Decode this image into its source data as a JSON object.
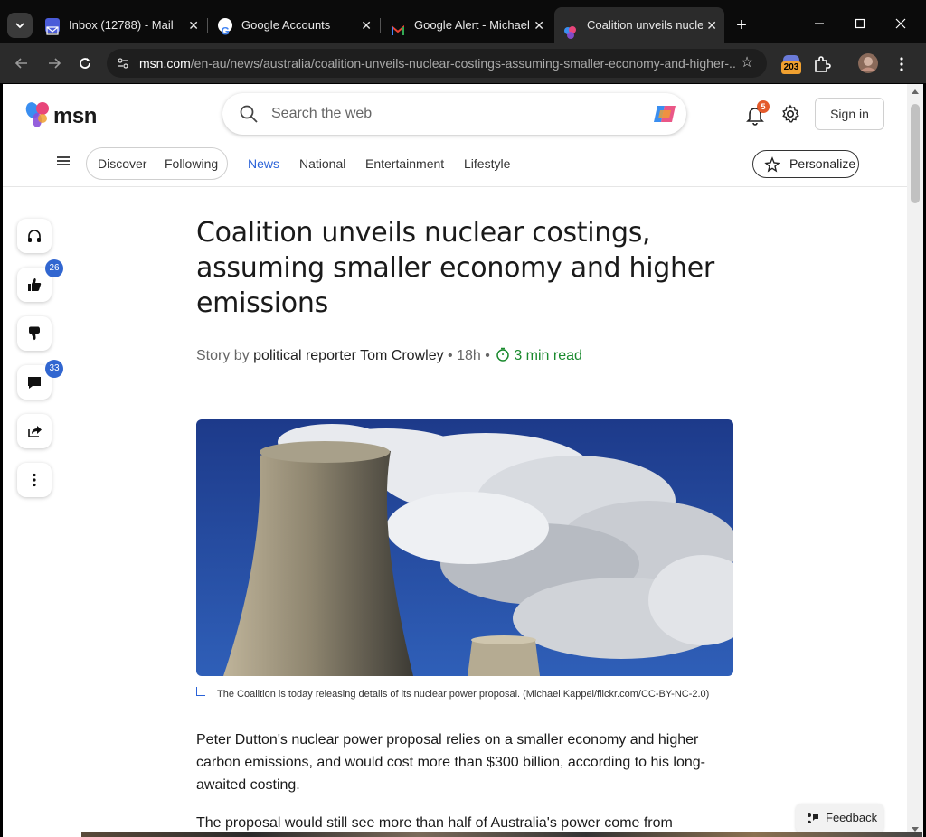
{
  "tabs": [
    {
      "title": "Inbox (12788) - Mail",
      "favicon": "mail-icon",
      "active": false
    },
    {
      "title": "Google Accounts",
      "favicon": "google-icon",
      "active": false
    },
    {
      "title": "Google Alert - Michael I",
      "favicon": "gmail-icon",
      "active": false
    },
    {
      "title": "Coalition unveils nuclea",
      "favicon": "msn-icon",
      "active": true
    }
  ],
  "address_bar": {
    "host": "msn.com",
    "path": "/en-au/news/australia/coalition-unveils-nuclear-costings-assuming-smaller-economy-and-higher-..."
  },
  "extensions": {
    "badge": "203"
  },
  "msn": {
    "logo_text": "msn",
    "search_placeholder": "Search the web",
    "notifications_count": "5",
    "sign_in_label": "Sign in",
    "nav_pills": [
      "Discover",
      "Following"
    ],
    "nav_links": [
      "News",
      "National",
      "Entertainment",
      "Lifestyle"
    ],
    "active_nav": "News",
    "personalize_label": "Personalize"
  },
  "rail": {
    "like_count": "26",
    "comment_count": "33"
  },
  "article": {
    "headline": "Coalition unveils nuclear costings, assuming smaller economy and higher emissions",
    "byline_prefix": "Story by",
    "author": "political reporter Tom Crowley",
    "sep": "•",
    "time_ago": "18h",
    "read_time": "3 min read",
    "caption": "The Coalition is today releasing details of its nuclear power proposal. (Michael Kappel/flickr.com/CC-BY-NC-2.0)",
    "paragraphs": [
      "Peter Dutton's nuclear power proposal relies on a smaller economy and higher carbon emissions, and would cost more than $300 billion, according to his long-awaited costing.",
      "The proposal would still see more than half of Australia's power come from"
    ]
  },
  "feedback_label": "Feedback",
  "colors": {
    "accent": "#2a62d8",
    "read_time": "#1a8a2e",
    "badge": "#3166d0",
    "notification": "#e45a2b"
  }
}
